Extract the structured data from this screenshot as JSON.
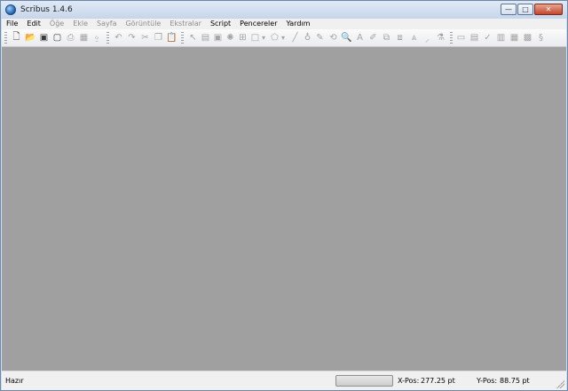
{
  "window": {
    "title": "Scribus 1.4.6",
    "controls": {
      "minimize": "—",
      "maximize": "□",
      "close": "✕"
    }
  },
  "menu": [
    {
      "label": "File",
      "enabled": true
    },
    {
      "label": "Edit",
      "enabled": true
    },
    {
      "label": "Öğe",
      "enabled": false
    },
    {
      "label": "Ekle",
      "enabled": false
    },
    {
      "label": "Sayfa",
      "enabled": false
    },
    {
      "label": "Görüntüle",
      "enabled": false
    },
    {
      "label": "Ekstralar",
      "enabled": false
    },
    {
      "label": "Script",
      "enabled": true
    },
    {
      "label": "Pencereler",
      "enabled": true
    },
    {
      "label": "Yardım",
      "enabled": true
    }
  ],
  "toolbar": {
    "new": {
      "icon": "new-document-icon",
      "glyph": "🗋"
    },
    "open": {
      "icon": "open-folder-icon",
      "glyph": "📂"
    },
    "save": {
      "icon": "save-icon",
      "glyph": "▣"
    },
    "close": {
      "icon": "close-document-icon",
      "glyph": "▢"
    },
    "print": {
      "icon": "print-icon",
      "glyph": "⎙"
    },
    "preflight": {
      "icon": "preflight-check-icon",
      "glyph": "▦"
    },
    "pdf": {
      "icon": "export-pdf-icon",
      "glyph": "⍚"
    },
    "undo": {
      "icon": "undo-icon",
      "glyph": "↶"
    },
    "redo": {
      "icon": "redo-icon",
      "glyph": "↷"
    },
    "cut": {
      "icon": "cut-icon",
      "glyph": "✂"
    },
    "copy": {
      "icon": "copy-icon",
      "glyph": "❐"
    },
    "paste": {
      "icon": "paste-icon",
      "glyph": "📋"
    },
    "select": {
      "icon": "select-pointer-icon",
      "glyph": "↖"
    },
    "text-frame": {
      "icon": "text-frame-icon",
      "glyph": "▤"
    },
    "image-frame": {
      "icon": "image-frame-icon",
      "glyph": "▣"
    },
    "render-frame": {
      "icon": "render-frame-icon",
      "glyph": "✺"
    },
    "table": {
      "icon": "table-icon",
      "glyph": "⊞"
    },
    "shape": {
      "icon": "shape-icon",
      "glyph": "□"
    },
    "polygon": {
      "icon": "polygon-icon",
      "glyph": "⬠"
    },
    "line": {
      "icon": "line-icon",
      "glyph": "╱"
    },
    "bezier": {
      "icon": "bezier-icon",
      "glyph": "♁"
    },
    "freehand": {
      "icon": "freehand-icon",
      "glyph": "✎"
    },
    "rotate": {
      "icon": "rotate-icon",
      "glyph": "⟲"
    },
    "zoom": {
      "icon": "zoom-icon",
      "glyph": "🔍"
    },
    "edit-content": {
      "icon": "edit-contents-icon",
      "glyph": "A"
    },
    "edit-text": {
      "icon": "edit-text-icon",
      "glyph": "✐"
    },
    "link-frames": {
      "icon": "link-frames-icon",
      "glyph": "⧉"
    },
    "unlink-frames": {
      "icon": "unlink-frames-icon",
      "glyph": "⧈"
    },
    "measure": {
      "icon": "measure-icon",
      "glyph": "⩓"
    },
    "copy-properties": {
      "icon": "copy-properties-icon",
      "glyph": "⸝"
    },
    "eyedropper": {
      "icon": "eyedropper-icon",
      "glyph": "⚗"
    },
    "pdf-button": {
      "icon": "pdf-push-button-icon",
      "glyph": "▭"
    },
    "pdf-text-field": {
      "icon": "pdf-text-field-icon",
      "glyph": "▤"
    },
    "pdf-checkbox": {
      "icon": "pdf-checkbox-icon",
      "glyph": "✓"
    },
    "pdf-combo": {
      "icon": "pdf-combo-box-icon",
      "glyph": "▥"
    },
    "pdf-list": {
      "icon": "pdf-list-box-icon",
      "glyph": "▦"
    },
    "text-annotation": {
      "icon": "text-annotation-icon",
      "glyph": "▩"
    },
    "link-annotation": {
      "icon": "link-annotation-icon",
      "glyph": "§"
    },
    "dropdown": "▾"
  },
  "status": {
    "message": "Hazır",
    "x_label": "X-Pos:",
    "x_value": "277.25 pt",
    "y_label": "Y-Pos:",
    "y_value": "88.75 pt"
  },
  "colors": {
    "workspace": "#a0a0a0",
    "menu_disabled": "#8d8d8d"
  }
}
